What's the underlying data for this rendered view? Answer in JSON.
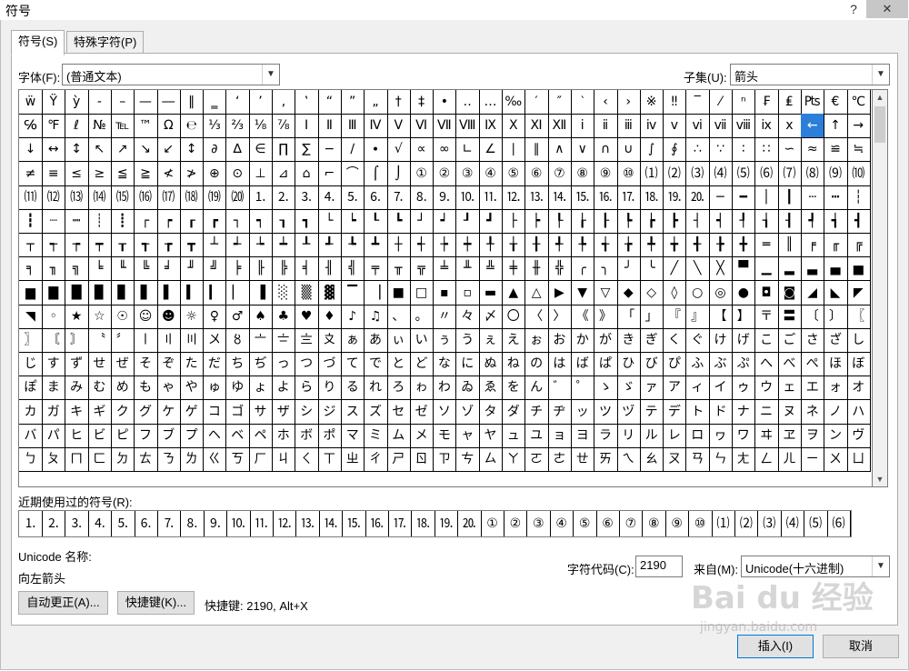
{
  "window": {
    "title": "符号",
    "help": "?",
    "close": "✕"
  },
  "tabs": [
    {
      "label": "符号(S)"
    },
    {
      "label": "特殊字符(P)"
    }
  ],
  "font": {
    "label": "字体(F):",
    "value": "(普通文本)"
  },
  "subset": {
    "label": "子集(U):",
    "value": "箭头"
  },
  "symbol_rows": [
    [
      "ẅ",
      "Ÿ",
      "ỳ",
      "‐",
      "–",
      "—",
      "―",
      "‖",
      "‗",
      "‘",
      "’",
      "‚",
      "‛",
      "“",
      "”",
      "„",
      "†",
      "‡",
      "•",
      "‥",
      "…",
      "‰",
      "′",
      "″",
      "‵",
      "‹",
      "›",
      "※",
      "‼",
      "‾",
      "⁄",
      "ⁿ",
      "₣",
      "₤",
      "₧",
      "€",
      "℃"
    ],
    [
      "℅",
      "℉",
      "ℓ",
      "№",
      "℡",
      "™",
      "Ω",
      "℮",
      "⅓",
      "⅔",
      "⅛",
      "⅞",
      "Ⅰ",
      "Ⅱ",
      "Ⅲ",
      "Ⅳ",
      "Ⅴ",
      "Ⅵ",
      "Ⅶ",
      "Ⅷ",
      "Ⅸ",
      "Ⅹ",
      "Ⅺ",
      "Ⅻ",
      "ⅰ",
      "ⅱ",
      "ⅲ",
      "ⅳ",
      "ⅴ",
      "ⅵ",
      "ⅶ",
      "ⅷ",
      "ⅸ",
      "ⅹ",
      "←",
      "↑",
      "→"
    ],
    [
      "↓",
      "↔",
      "↕",
      "↖",
      "↗",
      "↘",
      "↙",
      "↕",
      "∂",
      "∆",
      "∈",
      "∏",
      "∑",
      "−",
      "∕",
      "∙",
      "√",
      "∝",
      "∞",
      "∟",
      "∠",
      "∣",
      "∥",
      "∧",
      "∨",
      "∩",
      "∪",
      "∫",
      "∮",
      "∴",
      "∵",
      "∶",
      "∷",
      "∽",
      "≈",
      "≌",
      "≒"
    ],
    [
      "≠",
      "≡",
      "≤",
      "≥",
      "≦",
      "≧",
      "≮",
      "≯",
      "⊕",
      "⊙",
      "⊥",
      "⊿",
      "⌂",
      "⌐",
      "⌒",
      "⌠",
      "⌡",
      "①",
      "②",
      "③",
      "④",
      "⑤",
      "⑥",
      "⑦",
      "⑧",
      "⑨",
      "⑩",
      "⑴",
      "⑵",
      "⑶",
      "⑷",
      "⑸",
      "⑹",
      "⑺",
      "⑻",
      "⑼",
      "⑽"
    ],
    [
      "⑾",
      "⑿",
      "⒀",
      "⒁",
      "⒂",
      "⒃",
      "⒄",
      "⒅",
      "⒆",
      "⒇",
      "⒈",
      "⒉",
      "⒊",
      "⒋",
      "⒌",
      "⒍",
      "⒎",
      "⒏",
      "⒐",
      "⒑",
      "⒒",
      "⒓",
      "⒔",
      "⒕",
      "⒖",
      "⒗",
      "⒘",
      "⒙",
      "⒚",
      "⒛",
      "─",
      "━",
      "│",
      "┃",
      "┄",
      "┅",
      "┆"
    ],
    [
      "┇",
      "┈",
      "┉",
      "┊",
      "┋",
      "┌",
      "┍",
      "┎",
      "┏",
      "┐",
      "┑",
      "┒",
      "┓",
      "└",
      "┕",
      "┖",
      "┗",
      "┘",
      "┙",
      "┚",
      "┛",
      "├",
      "┝",
      "┞",
      "┟",
      "┠",
      "┡",
      "┢",
      "┣",
      "┤",
      "┥",
      "┦",
      "┧",
      "┨",
      "┩",
      "┪",
      "┫"
    ],
    [
      "┬",
      "┭",
      "┮",
      "┯",
      "┰",
      "┱",
      "┲",
      "┳",
      "┴",
      "┵",
      "┶",
      "┷",
      "┸",
      "┹",
      "┺",
      "┻",
      "┼",
      "┽",
      "┾",
      "┿",
      "╀",
      "╁",
      "╂",
      "╃",
      "╄",
      "╅",
      "╆",
      "╇",
      "╈",
      "╉",
      "╊",
      "╋",
      "═",
      "║",
      "╒",
      "╓",
      "╔"
    ],
    [
      "╕",
      "╖",
      "╗",
      "╘",
      "╙",
      "╚",
      "╛",
      "╜",
      "╝",
      "╞",
      "╟",
      "╠",
      "╡",
      "╢",
      "╣",
      "╤",
      "╥",
      "╦",
      "╧",
      "╨",
      "╩",
      "╪",
      "╫",
      "╬",
      "╭",
      "╮",
      "╯",
      "╰",
      "╱",
      "╲",
      "╳",
      "▀",
      "▁",
      "▂",
      "▃",
      "▄",
      "▅"
    ],
    [
      "▆",
      "▇",
      "█",
      "▉",
      "▊",
      "▋",
      "▌",
      "▍",
      "▎",
      "▏",
      "▐",
      "░",
      "▒",
      "▓",
      "▔",
      "▕",
      "■",
      "□",
      "▪",
      "▫",
      "▬",
      "▲",
      "△",
      "▶",
      "▼",
      "▽",
      "◆",
      "◇",
      "◊",
      "○",
      "◎",
      "●",
      "◘",
      "◙",
      "◢",
      "◣",
      "◤"
    ],
    [
      "◥",
      "◦",
      "★",
      "☆",
      "☉",
      "☺",
      "☻",
      "☼",
      "♀",
      "♂",
      "♠",
      "♣",
      "♥",
      "♦",
      "♪",
      "♫",
      "、",
      "。",
      "〃",
      "々",
      "〆",
      "〇",
      "〈",
      "〉",
      "《",
      "》",
      "「",
      "」",
      "『",
      "』",
      "【",
      "】",
      "〒",
      "〓",
      "〔",
      "〕",
      "〖"
    ],
    [
      "〗",
      "〘",
      "〙",
      "〝",
      "〞",
      "〡",
      "〢",
      "〣",
      "〤",
      "〥",
      "〦",
      "〧",
      "〨",
      "〩",
      "ぁ",
      "あ",
      "ぃ",
      "い",
      "ぅ",
      "う",
      "ぇ",
      "え",
      "ぉ",
      "お",
      "か",
      "が",
      "き",
      "ぎ",
      "く",
      "ぐ",
      "け",
      "げ",
      "こ",
      "ご",
      "さ",
      "ざ",
      "し"
    ],
    [
      "じ",
      "す",
      "ず",
      "せ",
      "ぜ",
      "そ",
      "ぞ",
      "た",
      "だ",
      "ち",
      "ぢ",
      "っ",
      "つ",
      "づ",
      "て",
      "で",
      "と",
      "ど",
      "な",
      "に",
      "ぬ",
      "ね",
      "の",
      "は",
      "ば",
      "ぱ",
      "ひ",
      "び",
      "ぴ",
      "ふ",
      "ぶ",
      "ぷ",
      "へ",
      "べ",
      "ぺ",
      "ほ",
      "ぼ"
    ],
    [
      "ぽ",
      "ま",
      "み",
      "む",
      "め",
      "も",
      "ゃ",
      "や",
      "ゅ",
      "ゆ",
      "ょ",
      "よ",
      "ら",
      "り",
      "る",
      "れ",
      "ろ",
      "ゎ",
      "わ",
      "ゐ",
      "ゑ",
      "を",
      "ん",
      "゛",
      "゜",
      "ゝ",
      "ゞ",
      "ァ",
      "ア",
      "ィ",
      "イ",
      "ゥ",
      "ウ",
      "ェ",
      "エ",
      "ォ",
      "オ"
    ],
    [
      "カ",
      "ガ",
      "キ",
      "ギ",
      "ク",
      "グ",
      "ケ",
      "ゲ",
      "コ",
      "ゴ",
      "サ",
      "ザ",
      "シ",
      "ジ",
      "ス",
      "ズ",
      "セ",
      "ゼ",
      "ソ",
      "ゾ",
      "タ",
      "ダ",
      "チ",
      "ヂ",
      "ッ",
      "ツ",
      "ヅ",
      "テ",
      "デ",
      "ト",
      "ド",
      "ナ",
      "ニ",
      "ヌ",
      "ネ",
      "ノ",
      "ハ"
    ],
    [
      "バ",
      "パ",
      "ヒ",
      "ビ",
      "ピ",
      "フ",
      "ブ",
      "プ",
      "ヘ",
      "ベ",
      "ペ",
      "ホ",
      "ボ",
      "ポ",
      "マ",
      "ミ",
      "ム",
      "メ",
      "モ",
      "ャ",
      "ヤ",
      "ュ",
      "ユ",
      "ョ",
      "ヨ",
      "ラ",
      "リ",
      "ル",
      "レ",
      "ロ",
      "ヮ",
      "ワ",
      "ヰ",
      "ヱ",
      "ヲ",
      "ン",
      "ヴ"
    ],
    [
      "ㄅ",
      "ㄆ",
      "ㄇ",
      "ㄈ",
      "ㄉ",
      "ㄊ",
      "ㄋ",
      "ㄌ",
      "ㄍ",
      "ㄎ",
      "ㄏ",
      "ㄐ",
      "ㄑ",
      "ㄒ",
      "ㄓ",
      "ㄔ",
      "ㄕ",
      "ㄖ",
      "ㄗ",
      "ㄘ",
      "ㄙ",
      "ㄚ",
      "ㄛ",
      "ㄜ",
      "ㄝ",
      "ㄞ",
      "ㄟ",
      "ㄠ",
      "ㄡ",
      "ㄢ",
      "ㄣ",
      "ㄤ",
      "ㄥ",
      "ㄦ",
      "ㄧ",
      "ㄨ",
      "ㄩ"
    ]
  ],
  "selected_symbol": "←",
  "recent": {
    "label": "近期使用过的符号(R):",
    "symbols": [
      "⒈",
      "⒉",
      "⒊",
      "⒋",
      "⒌",
      "⒍",
      "⒎",
      "⒏",
      "⒐",
      "⒑",
      "⒒",
      "⒓",
      "⒔",
      "⒕",
      "⒖",
      "⒗",
      "⒘",
      "⒙",
      "⒚",
      "⒛",
      "①",
      "②",
      "③",
      "④",
      "⑤",
      "⑥",
      "⑦",
      "⑧",
      "⑨",
      "⑩",
      "⑴",
      "⑵",
      "⑶",
      "⑷",
      "⑸",
      "⑹"
    ]
  },
  "unicode_name_label": "Unicode 名称:",
  "unicode_name_value": "向左箭头",
  "char_code": {
    "label": "字符代码(C):",
    "value": "2190"
  },
  "from": {
    "label": "来自(M):",
    "value": "Unicode(十六进制)"
  },
  "buttons": {
    "autocorrect": "自动更正(A)...",
    "shortcut": "快捷键(K)...",
    "shortcut_text": "快捷键: 2190, Alt+X",
    "insert": "插入(I)",
    "cancel": "取消"
  },
  "watermark": {
    "text": "Bai du 经验",
    "sub": "jingyan.baidu.com"
  }
}
